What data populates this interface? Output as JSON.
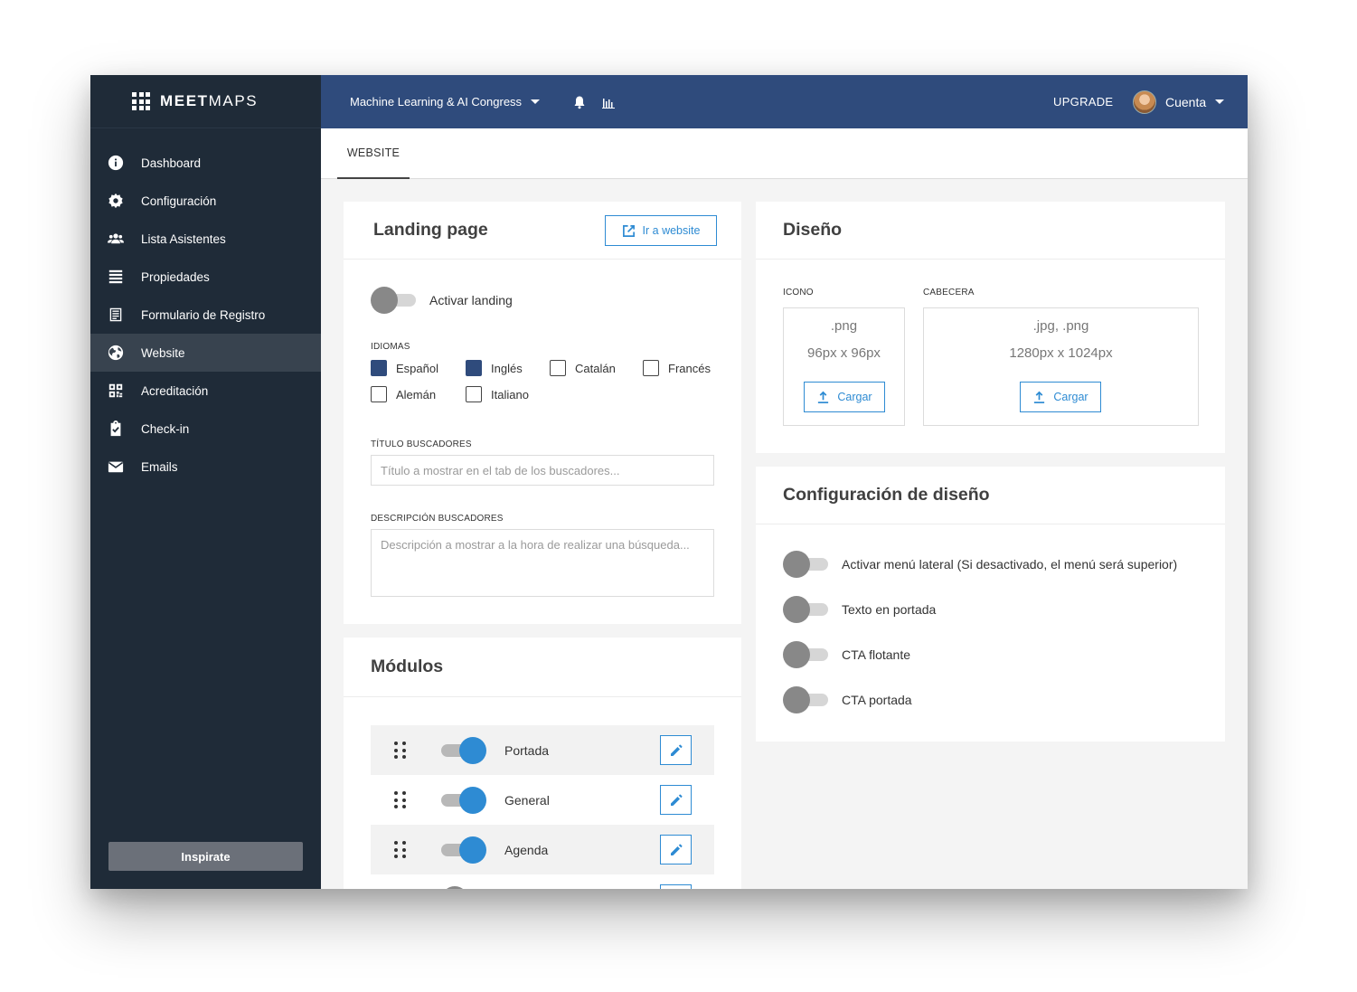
{
  "brand": {
    "bold": "MEET",
    "light": "MAPS"
  },
  "sidebar": {
    "items": [
      {
        "label": "Dashboard",
        "icon": "info-icon"
      },
      {
        "label": "Configuración",
        "icon": "gear-icon"
      },
      {
        "label": "Lista Asistentes",
        "icon": "users-icon"
      },
      {
        "label": "Propiedades",
        "icon": "list-icon"
      },
      {
        "label": "Formulario de Registro",
        "icon": "form-icon"
      },
      {
        "label": "Website",
        "icon": "globe-icon",
        "active": true
      },
      {
        "label": "Acreditación",
        "icon": "qr-icon"
      },
      {
        "label": "Check-in",
        "icon": "clipboard-check-icon"
      },
      {
        "label": "Emails",
        "icon": "mail-icon"
      }
    ],
    "inspirate_label": "Inspirate"
  },
  "topbar": {
    "event_name": "Machine Learning & AI Congress",
    "upgrade_label": "UPGRADE",
    "account_label": "Cuenta"
  },
  "tabs": {
    "website": "WEBSITE"
  },
  "landing": {
    "title": "Landing page",
    "go_website_label": "Ir a website",
    "activate_label": "Activar landing",
    "activate_on": false,
    "languages_label": "IDIOMAS",
    "languages": [
      {
        "label": "Español",
        "checked": true
      },
      {
        "label": "Inglés",
        "checked": true
      },
      {
        "label": "Catalán",
        "checked": false
      },
      {
        "label": "Francés",
        "checked": false
      },
      {
        "label": "Alemán",
        "checked": false
      },
      {
        "label": "Italiano",
        "checked": false
      }
    ],
    "seo_title_label": "TÍTULO BUSCADORES",
    "seo_title_placeholder": "Título a mostrar en el tab de los buscadores...",
    "seo_desc_label": "DESCRIPCIÓN BUSCADORES",
    "seo_desc_placeholder": "Descripción a mostrar a la hora de realizar una búsqueda..."
  },
  "modules": {
    "title": "Módulos",
    "items": [
      {
        "label": "Portada",
        "on": true
      },
      {
        "label": "General",
        "on": true
      },
      {
        "label": "Agenda",
        "on": true
      }
    ]
  },
  "design": {
    "title": "Diseño",
    "icon_label": "ICONO",
    "icon_format": ".png",
    "icon_size": "96px x 96px",
    "header_label": "CABECERA",
    "header_format": ".jpg, .png",
    "header_size": "1280px x 1024px",
    "upload_label": "Cargar"
  },
  "design_config": {
    "title": "Configuración de diseño",
    "options": [
      {
        "label": "Activar menú lateral (Si desactivado, el menú será superior)",
        "on": false
      },
      {
        "label": "Texto en portada",
        "on": false
      },
      {
        "label": "CTA flotante",
        "on": false
      },
      {
        "label": "CTA portada",
        "on": false
      }
    ]
  },
  "colors": {
    "sidebar": "#1f2b38",
    "topbar": "#2f4b7c",
    "accent": "#2e8bd3"
  }
}
